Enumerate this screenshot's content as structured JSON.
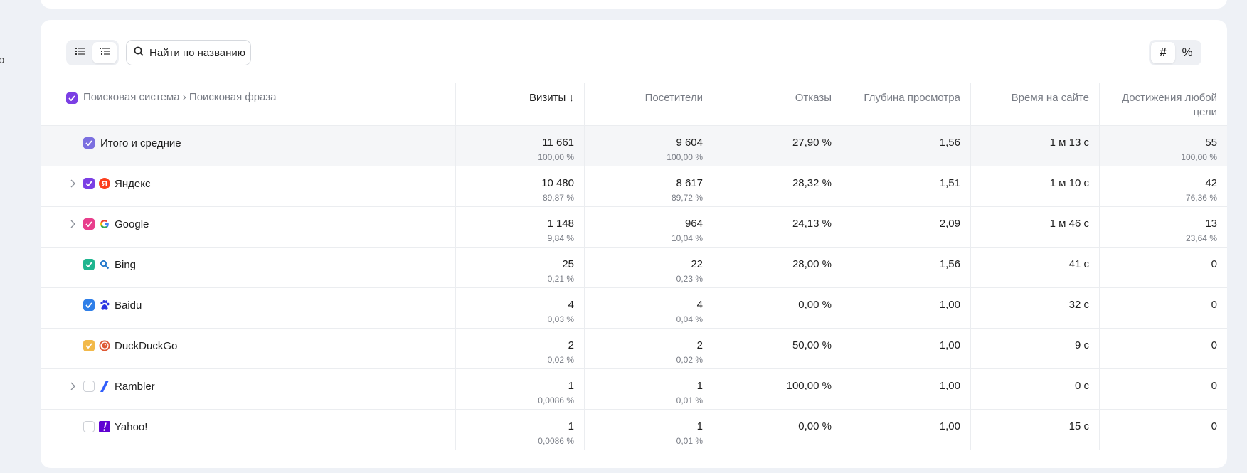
{
  "left_edge_char": "о",
  "toolbar": {
    "search_placeholder": "Найти по названию",
    "unit_absolute": "#",
    "unit_percent": "%"
  },
  "table": {
    "dim_header": "Поисковая система › Поисковая фраза",
    "columns": [
      {
        "label": "Визиты ↓",
        "sorted": true
      },
      {
        "label": "Посетители"
      },
      {
        "label": "Отказы"
      },
      {
        "label": "Глубина просмотра"
      },
      {
        "label": "Время на сайте"
      },
      {
        "label": "Достижения любой цели"
      }
    ],
    "total": {
      "name": "Итого и средние",
      "checkbox_color": "#7b6fe0",
      "visits": "11 661",
      "visits_pct": "100,00 %",
      "visitors": "9 604",
      "visitors_pct": "100,00 %",
      "bounce": "27,90 %",
      "depth": "1,56",
      "time": "1 м 13 с",
      "goals": "55",
      "goals_pct": "100,00 %"
    },
    "rows": [
      {
        "name": "Яндекс",
        "expandable": true,
        "checked": true,
        "checkbox_color": "#7b3fe4",
        "icon": "yandex-icon",
        "visits": "10 480",
        "visits_pct": "89,87 %",
        "visitors": "8 617",
        "visitors_pct": "89,72 %",
        "bounce": "28,32 %",
        "depth": "1,51",
        "time": "1 м 10 с",
        "goals": "42",
        "goals_pct": "76,36 %"
      },
      {
        "name": "Google",
        "expandable": true,
        "checked": true,
        "checkbox_color": "#e83e8c",
        "icon": "google-icon",
        "visits": "1 148",
        "visits_pct": "9,84 %",
        "visitors": "964",
        "visitors_pct": "10,04 %",
        "bounce": "24,13 %",
        "depth": "2,09",
        "time": "1 м 46 с",
        "goals": "13",
        "goals_pct": "23,64 %"
      },
      {
        "name": "Bing",
        "expandable": false,
        "checked": true,
        "checkbox_color": "#1fb58f",
        "icon": "bing-icon",
        "visits": "25",
        "visits_pct": "0,21 %",
        "visitors": "22",
        "visitors_pct": "0,23 %",
        "bounce": "28,00 %",
        "depth": "1,56",
        "time": "41 с",
        "goals": "0",
        "goals_pct": ""
      },
      {
        "name": "Baidu",
        "expandable": false,
        "checked": true,
        "checkbox_color": "#2f7fe8",
        "icon": "baidu-icon",
        "visits": "4",
        "visits_pct": "0,03 %",
        "visitors": "4",
        "visitors_pct": "0,04 %",
        "bounce": "0,00 %",
        "depth": "1,00",
        "time": "32 с",
        "goals": "0",
        "goals_pct": ""
      },
      {
        "name": "DuckDuckGo",
        "expandable": false,
        "checked": true,
        "checkbox_color": "#f2b94a",
        "icon": "duckduckgo-icon",
        "visits": "2",
        "visits_pct": "0,02 %",
        "visitors": "2",
        "visitors_pct": "0,02 %",
        "bounce": "50,00 %",
        "depth": "1,00",
        "time": "9 с",
        "goals": "0",
        "goals_pct": ""
      },
      {
        "name": "Rambler",
        "expandable": true,
        "checked": false,
        "checkbox_color": "",
        "icon": "rambler-icon",
        "visits": "1",
        "visits_pct": "0,0086 %",
        "visitors": "1",
        "visitors_pct": "0,01 %",
        "bounce": "100,00 %",
        "depth": "1,00",
        "time": "0 с",
        "goals": "0",
        "goals_pct": ""
      },
      {
        "name": "Yahoo!",
        "expandable": false,
        "checked": false,
        "checkbox_color": "",
        "icon": "yahoo-icon",
        "visits": "1",
        "visits_pct": "0,0086 %",
        "visitors": "1",
        "visitors_pct": "0,01 %",
        "bounce": "0,00 %",
        "depth": "1,00",
        "time": "15 с",
        "goals": "0",
        "goals_pct": ""
      }
    ]
  }
}
